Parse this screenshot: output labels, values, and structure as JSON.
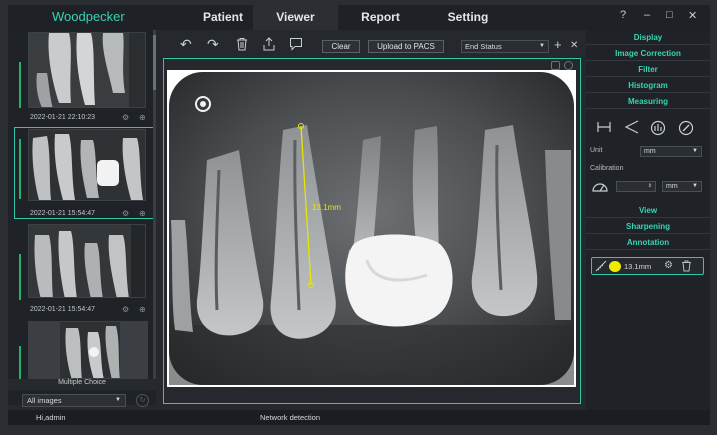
{
  "app": {
    "logo": "Woodpecker"
  },
  "tabs": [
    {
      "label": "Patient",
      "active": false
    },
    {
      "label": "Viewer",
      "active": true
    },
    {
      "label": "Report",
      "active": false
    },
    {
      "label": "Setting",
      "active": false
    }
  ],
  "window_controls": {
    "help": "?",
    "minimize": "–",
    "maximize": "□",
    "close": "✕"
  },
  "thumbnails": [
    {
      "timestamp": "2022-01-21 22:10:23"
    },
    {
      "timestamp": "2022-01-21 15:54:47"
    },
    {
      "timestamp": "2022-01-21 15:54:47"
    }
  ],
  "left_footer": {
    "multiple_choice": "Multiple Choice",
    "filter_value": "All images"
  },
  "toolbar": {
    "clear_label": "Clear",
    "upload_label": "Upload to PACS",
    "status_value": "End Status",
    "add": "+",
    "close": "✕"
  },
  "measurement": {
    "label": "13.1mm",
    "color": "#e6e600"
  },
  "right_panel": {
    "sections": [
      "Display",
      "Image Correction",
      "Filter",
      "Histogram",
      "Measuring"
    ],
    "unit_label": "Unit",
    "unit_value": "mm",
    "calibration_label": "Calibration",
    "calibration_value": "",
    "calibration_unit": "mm",
    "sections_lower": [
      "View",
      "Sharpening",
      "Annotation"
    ],
    "annotation_value": "13.1mm"
  },
  "status": {
    "user": "Hi,admin",
    "message": "Network detection"
  },
  "colors": {
    "accent": "#2ec7a8",
    "bg": "#25282c",
    "measure": "#e6e600"
  }
}
